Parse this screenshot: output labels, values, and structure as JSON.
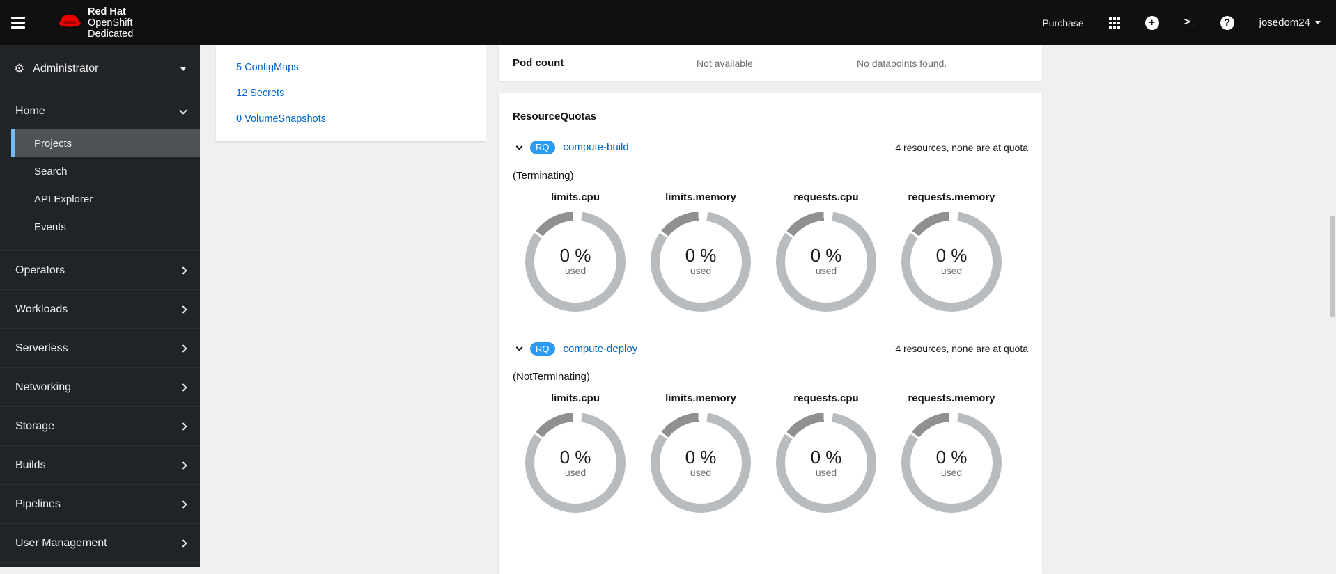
{
  "masthead": {
    "brand": {
      "line1": "Red Hat",
      "line2": "OpenShift",
      "line3": "Dedicated"
    },
    "purchase_label": "Purchase",
    "username": "josedom24"
  },
  "sidebar": {
    "perspective_label": "Administrator",
    "home": {
      "label": "Home",
      "items": [
        {
          "label": "Projects",
          "selected": true
        },
        {
          "label": "Search"
        },
        {
          "label": "API Explorer"
        },
        {
          "label": "Events"
        }
      ]
    },
    "sections": [
      {
        "label": "Operators"
      },
      {
        "label": "Workloads"
      },
      {
        "label": "Serverless"
      },
      {
        "label": "Networking"
      },
      {
        "label": "Storage"
      },
      {
        "label": "Builds"
      },
      {
        "label": "Pipelines"
      },
      {
        "label": "User Management"
      }
    ]
  },
  "main": {
    "metrics_card": {
      "metric_name": "Pod count",
      "metric_value": "Not available",
      "metric_note": "No datapoints found."
    },
    "inventory_card": {
      "links": [
        {
          "label": "5 ConfigMaps"
        },
        {
          "label": "12 Secrets"
        },
        {
          "label": "0 VolumeSnapshots"
        }
      ]
    },
    "quota_card": {
      "title": "ResourceQuotas",
      "quotas": [
        {
          "badge": "RQ",
          "name": "compute-build",
          "summary": "4 resources, none are at quota",
          "scope": "(Terminating)",
          "gauges": [
            {
              "title": "limits.cpu",
              "percent_label": "0 %",
              "sub_label": "used"
            },
            {
              "title": "limits.memory",
              "percent_label": "0 %",
              "sub_label": "used"
            },
            {
              "title": "requests.cpu",
              "percent_label": "0 %",
              "sub_label": "used"
            },
            {
              "title": "requests.memory",
              "percent_label": "0 %",
              "sub_label": "used"
            }
          ]
        },
        {
          "badge": "RQ",
          "name": "compute-deploy",
          "summary": "4 resources, none are at quota",
          "scope": "(NotTerminating)",
          "gauges": [
            {
              "title": "limits.cpu",
              "percent_label": "0 %",
              "sub_label": "used"
            },
            {
              "title": "limits.memory",
              "percent_label": "0 %",
              "sub_label": "used"
            },
            {
              "title": "requests.cpu",
              "percent_label": "0 %",
              "sub_label": "used"
            },
            {
              "title": "requests.memory",
              "percent_label": "0 %",
              "sub_label": "used"
            }
          ]
        }
      ]
    }
  },
  "colors": {
    "masthead_bg": "#0f0f0f",
    "sidebar_bg": "#212427",
    "selected_item_bg": "#4f5255",
    "selected_item_border": "#73bcf7",
    "link_blue": "#0066cc",
    "badge_blue": "#2b9af3",
    "donut_track": "#b9bcbe",
    "donut_threshold": "#8e9092",
    "red_hat_red": "#ee0000"
  },
  "chart_data": [
    {
      "type": "donut",
      "group": "compute-build (Terminating)",
      "gauges": [
        {
          "label": "limits.cpu",
          "percent_used": 0
        },
        {
          "label": "limits.memory",
          "percent_used": 0
        },
        {
          "label": "requests.cpu",
          "percent_used": 0
        },
        {
          "label": "requests.memory",
          "percent_used": 0
        }
      ]
    },
    {
      "type": "donut",
      "group": "compute-deploy (NotTerminating)",
      "gauges": [
        {
          "label": "limits.cpu",
          "percent_used": 0
        },
        {
          "label": "limits.memory",
          "percent_used": 0
        },
        {
          "label": "requests.cpu",
          "percent_used": 0
        },
        {
          "label": "requests.memory",
          "percent_used": 0
        }
      ]
    }
  ]
}
